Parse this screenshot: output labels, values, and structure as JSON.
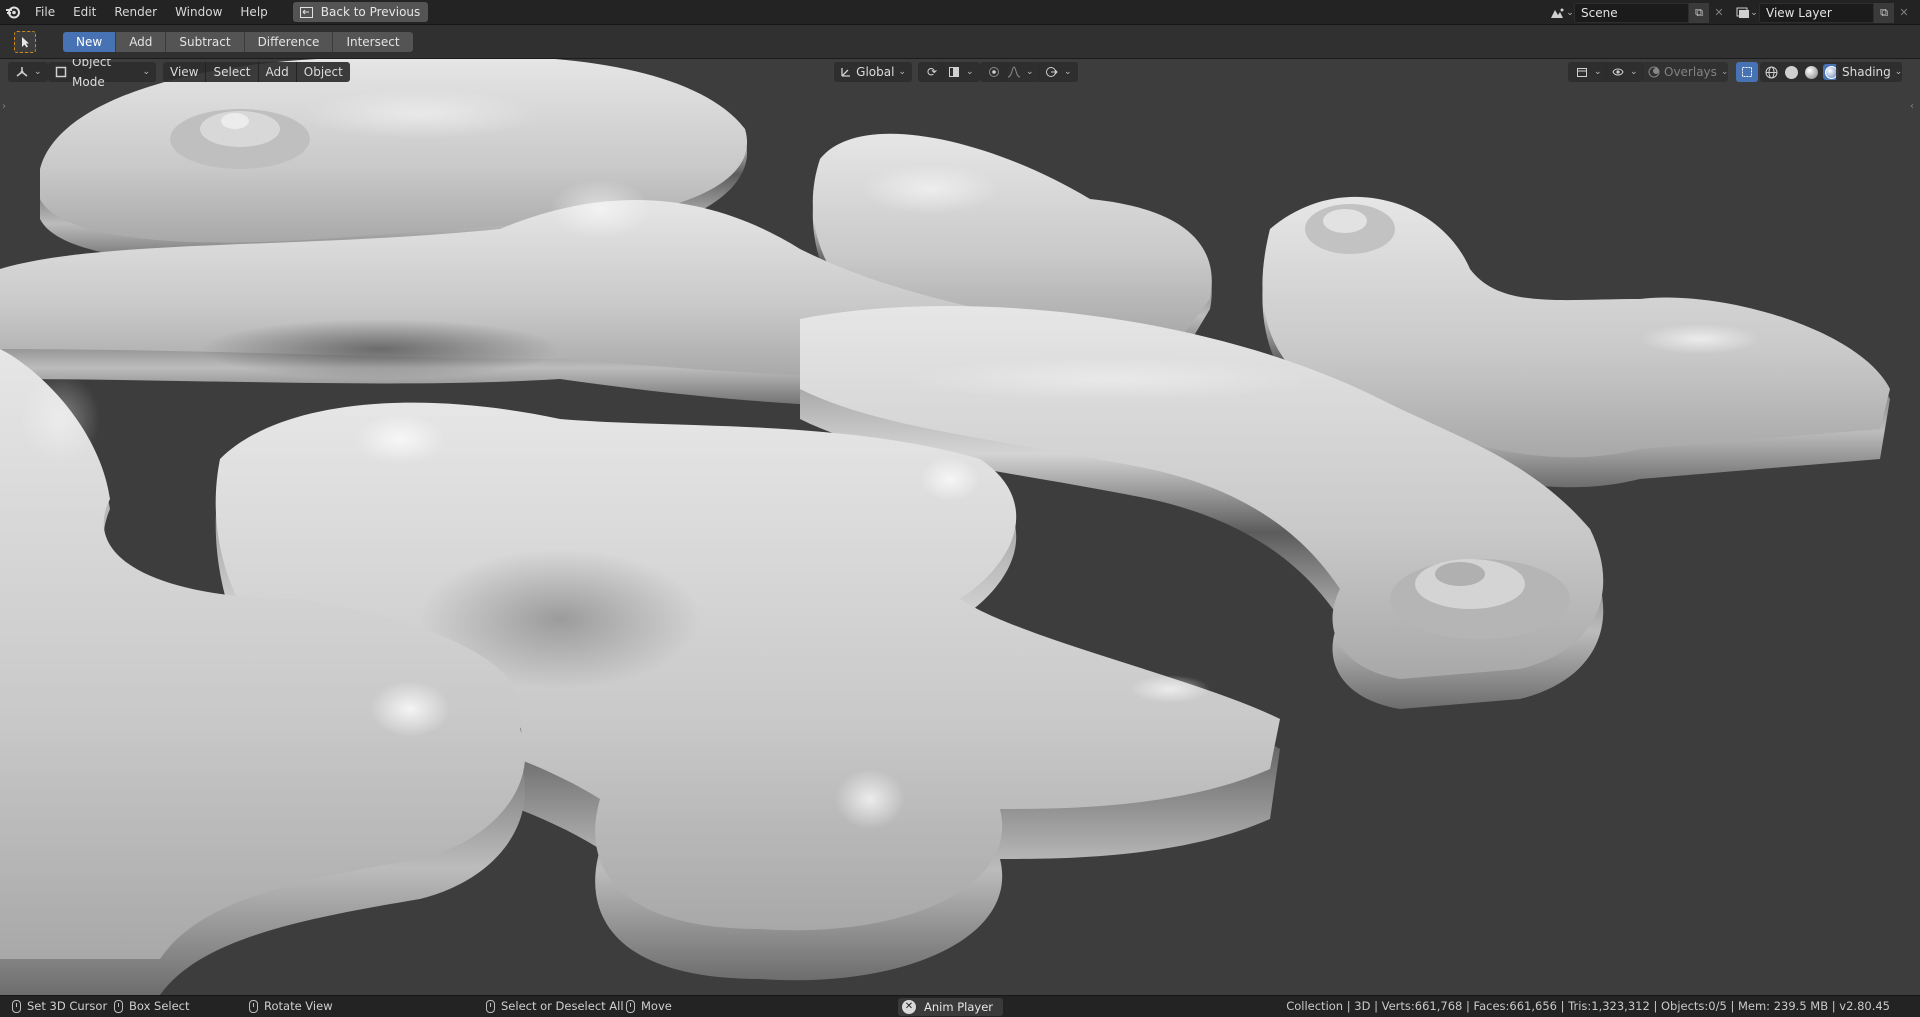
{
  "menu": [
    "File",
    "Edit",
    "Render",
    "Window",
    "Help"
  ],
  "back_button": "Back to Previous",
  "scene_field": "Scene",
  "view_layer_field": "View Layer",
  "tool_header": {
    "buttons": [
      "New",
      "Add",
      "Subtract",
      "Difference",
      "Intersect"
    ],
    "active": "New"
  },
  "viewport_header": {
    "mode": "Object Mode",
    "menus": [
      "View",
      "Select",
      "Add",
      "Object"
    ],
    "orientation": "Global",
    "overlays_label": "Overlays",
    "shading_label": "Shading"
  },
  "colors": {
    "accent": "#4772b3",
    "viewport_bg": "#3d3d3d",
    "surface_light": "#d9d9d9",
    "surface_shadow": "#6a6a6a"
  },
  "statusbar": {
    "hints": [
      {
        "key": "mouse-left",
        "label": "Set 3D Cursor"
      },
      {
        "key": "mouse-left-drag",
        "label": "Box Select"
      },
      {
        "key": "mouse-middle",
        "label": "Rotate View"
      },
      {
        "key": "mouse-left",
        "label": "Select or Deselect All"
      },
      {
        "key": "mouse-left-drag",
        "label": "Move"
      }
    ],
    "anim_player": "Anim Player",
    "stats": "Collection | 3D | Verts:661,768 | Faces:661,656 | Tris:1,323,312 | Objects:0/5 | Mem: 239.5 MB | v2.80.45"
  }
}
